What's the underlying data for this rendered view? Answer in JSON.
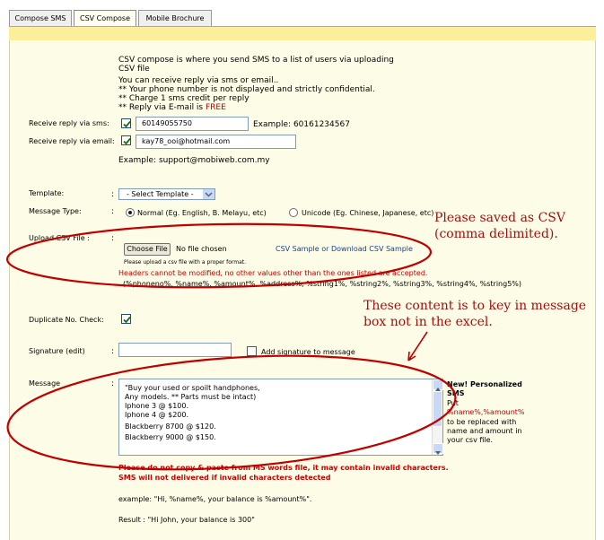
{
  "tabs": [
    {
      "label": "Compose SMS"
    },
    {
      "label": "CSV Compose"
    },
    {
      "label": "Mobile Brochure"
    }
  ],
  "intro": {
    "line1": "CSV compose is where you send SMS to a list of users via uploading",
    "line2": "CSV file",
    "line3": "You can receive reply via sms or email..",
    "line4": "** Your phone number is not displayed and strictly confidential.",
    "line5": "** Charge 1 sms credit per reply",
    "line6_prefix": "** Reply via E-mail is ",
    "line6_free": "FREE"
  },
  "reply_sms": {
    "label": "Receive reply via sms:",
    "value": "60149055750",
    "example": "Example: 60161234567"
  },
  "reply_email": {
    "label": "Receive reply via email:",
    "value": "kay78_ooi@hotmail.com",
    "example": "Example: support@mobiweb.com.my"
  },
  "template": {
    "label": "Template:",
    "selected": "- Select Template -"
  },
  "message_type": {
    "label": "Message Type:",
    "normal": "Normal (Eg. English, B. Melayu, etc)",
    "unicode": "Unicode (Eg. Chinese, Japanese, etc)"
  },
  "upload": {
    "label": "Upload CSV File :",
    "button": "Choose File",
    "no_file": "No file chosen",
    "sample_csv": "CSV Sample",
    "or": " or ",
    "download_sample": "Download CSV Sample",
    "hint": "Please upload a csv file with a proper format.",
    "warning": "Headers cannot be modified, no other values other than the ones listed are accepted.",
    "fields": "(%phoneno%, %name%, %amount%, %address%, %string1%, %string2%, %string3%, %string4%, %string5%)"
  },
  "duplicate": {
    "label": "Duplicate No. Check:"
  },
  "signature": {
    "label": "Signature (edit)",
    "add_label": "Add signature to message"
  },
  "message": {
    "label": "Message",
    "lines": [
      "\"Buy your used or spoilt handphones,",
      "Any models. ** Parts must be intact)",
      "Iphone 3 @ $100.",
      "Iphone 4 @ $200.",
      "Blackberry 8700 @ $120.",
      "Blackberry 9000 @ $150."
    ]
  },
  "personalized": {
    "title1": "New! Personalized",
    "title2": "SMS",
    "body1": "Put",
    "body2": "%name%,%amount%",
    "body3": "to be replaced with",
    "body4": "name and amount in",
    "body5": "your csv file."
  },
  "warnings": {
    "line1": "Please do not copy & paste from MS words file, it may contain invalid characters.",
    "line2": "SMS will not delivered if invalid characters detected"
  },
  "example": {
    "line": "example: \"Hi, %name%, your balance is %amount%\".",
    "result": "Result : \"Hi John, your balance is 300\""
  },
  "annotations": {
    "csv_note1": "Please saved as CSV",
    "csv_note2": "(comma delimited).",
    "msg_note1": "These content is to key in message",
    "msg_note2": "box not in the excel."
  },
  "colors": {
    "band": "#fbef9c",
    "panel": "#fdfde7",
    "annotation": "#a10f0f",
    "warning": "#cc0000"
  }
}
